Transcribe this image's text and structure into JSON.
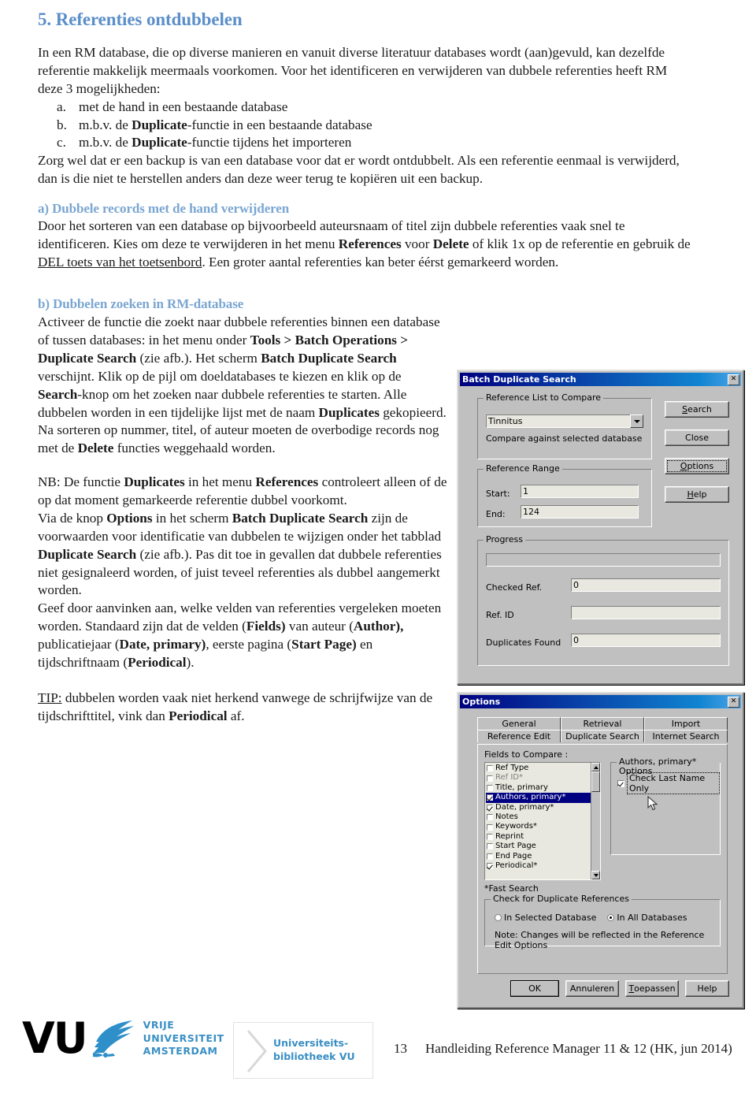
{
  "document": {
    "section_title": "5. Referenties ontdubbelen",
    "intro_p1_a": "In een RM database, die op diverse manieren en vanuit diverse literatuur databases wordt (aan)gevuld, kan dezelfde referentie makkelijk meermaals voorkomen. Voor het identificeren en verwijderen van dubbele referenties heeft RM deze 3 mogelijkheden:",
    "list": [
      {
        "marker": "a.",
        "pre": "met de hand in een bestaande database",
        "bold": "",
        "post": ""
      },
      {
        "marker": "b.",
        "pre": "m.b.v. de ",
        "bold": "Duplicate",
        "post": "-functie in een bestaande database"
      },
      {
        "marker": "c.",
        "pre": "m.b.v. de ",
        "bold": "Duplicate",
        "post": "-functie tijdens het importeren"
      }
    ],
    "intro_p2": "Zorg wel dat er een backup is van een database voor dat er wordt ontdubbelt. Als een referentie eenmaal is verwijderd, dan is die niet te herstellen anders dan deze weer terug te kopiëren uit een backup.",
    "sub_a_title": "a) Dubbele records met de hand verwijderen",
    "sub_a_body_1": "Door het sorteren van een database op bijvoorbeeld auteursnaam of titel zijn dubbele referenties vaak snel te identificeren. Kies om deze te verwijderen in het menu ",
    "sub_a_b1": "References",
    "sub_a_body_2": " voor ",
    "sub_a_b2": "Delete",
    "sub_a_body_3": " of klik 1x op de referentie en gebruik de ",
    "sub_a_u1": "DEL toets van het toetsenbord",
    "sub_a_body_4": ". Een groter aantal referenties kan beter éérst gemarkeerd worden.",
    "sub_b_title": "b) Dubbelen zoeken in RM-database",
    "sub_b_body_1": "Activeer de functie die zoekt naar dubbele referenties binnen een database of tussen databases: in het menu onder ",
    "sub_b_b1": "Tools > Batch Operations > Duplicate Search",
    "sub_b_body_2": " (zie afb.). Het scherm ",
    "sub_b_b2": "Batch Duplicate Search",
    "sub_b_body_3": " verschijnt. Klik op de pijl om doeldatabases te kiezen en klik op de ",
    "sub_b_b3": "Search",
    "sub_b_body_4": "-knop om het zoeken naar dubbele referenties te starten. Alle dubbelen worden in een tijdelijke lijst met de naam ",
    "sub_b_b4": "Duplicates",
    "sub_b_body_5": " gekopieerd. Na sorteren op nummer, titel, of auteur moeten de overbodige records nog met de ",
    "sub_b_b5": "Delete",
    "sub_b_body_6": " functies weggehaald worden.",
    "nb_1": "NB: De functie ",
    "nb_b1": "Duplicates",
    "nb_2": " in het menu ",
    "nb_b2": "References",
    "nb_3": " controleert alleen of de op dat moment gemarkeerde referentie dubbel voorkomt.",
    "via_1": "Via de knop ",
    "via_b1": "Options",
    "via_2": " in het scherm ",
    "via_b2": "Batch Duplicate Search",
    "via_3": " zijn de voorwaarden voor identificatie van dubbelen te wijzigen onder het tabblad ",
    "via_b3": "Duplicate Search",
    "via_4": " (zie afb.). Pas dit toe in gevallen dat dubbele referenties niet gesignaleerd worden, of juist teveel referenties als dubbel aangemerkt worden.",
    "geef_1": "Geef door aanvinken aan, welke velden van referenties vergeleken moeten worden. Standaard zijn dat de velden (",
    "geef_b1": "Fields)",
    "geef_2": " van auteur (",
    "geef_b2": "Author),",
    "geef_3": " publicatiejaar (",
    "geef_b3": "Date, primary)",
    "geef_4": ", eerste pagina (",
    "geef_b4": "Start Page)",
    "geef_5": " en tijdschriftnaam (",
    "geef_b5": "Periodical",
    "geef_6": ").",
    "tip_u": "TIP:",
    "tip_1": " dubbelen worden vaak niet herkend vanwege de schrijfwijze van de tijdschrifttitel, vink dan ",
    "tip_b1": "Periodical",
    "tip_2": " af."
  },
  "colors": {
    "heading": "#5b8fc9",
    "subheading": "#7aa6d2",
    "vu_blue": "#3a8fc4",
    "titlebar_start": "#000080",
    "titlebar_end": "#1084d0",
    "dialog_face": "#c0c0c0",
    "selection": "#000080"
  },
  "batch_dialog": {
    "title": "Batch Duplicate Search",
    "close_glyph": "✕",
    "ref_list_group": "Reference List to Compare",
    "ref_list_value": "Tinnitus",
    "compare_note": "Compare against selected database",
    "range_group": "Reference Range",
    "start_label": "Start:",
    "start_value": "1",
    "end_label": "End:",
    "end_value": "124",
    "progress_group": "Progress",
    "checked_label": "Checked Ref.",
    "checked_value": "0",
    "refid_label": "Ref. ID",
    "refid_value": "",
    "dupfound_label": "Duplicates Found",
    "dupfound_value": "0",
    "buttons": [
      {
        "label": "Search",
        "accel": "S"
      },
      {
        "label": "Close",
        "accel": ""
      },
      {
        "label": "Options",
        "accel": "O"
      },
      {
        "label": "Help",
        "accel": "H"
      }
    ]
  },
  "options_dialog": {
    "title": "Options",
    "close_glyph": "✕",
    "tabs_row1": [
      "General",
      "Retrieval",
      "Import"
    ],
    "tabs_row2": [
      "Reference Edit",
      "Duplicate Search",
      "Internet Search"
    ],
    "active_tab": "Duplicate Search",
    "fields_label": "Fields to Compare :",
    "fields": [
      {
        "label": "Ref Type",
        "checked": false,
        "selected": false,
        "dim": false
      },
      {
        "label": "Ref ID*",
        "checked": false,
        "selected": false,
        "dim": true
      },
      {
        "label": "Title, primary",
        "checked": false,
        "selected": false,
        "dim": false
      },
      {
        "label": "Authors, primary*",
        "checked": true,
        "selected": true,
        "dim": false
      },
      {
        "label": "Date, primary*",
        "checked": true,
        "selected": false,
        "dim": false
      },
      {
        "label": "Notes",
        "checked": false,
        "selected": false,
        "dim": false
      },
      {
        "label": "Keywords*",
        "checked": false,
        "selected": false,
        "dim": false
      },
      {
        "label": "Reprint",
        "checked": false,
        "selected": false,
        "dim": false
      },
      {
        "label": "Start Page",
        "checked": false,
        "selected": false,
        "dim": false
      },
      {
        "label": "End Page",
        "checked": false,
        "selected": false,
        "dim": false
      },
      {
        "label": "Periodical*",
        "checked": true,
        "selected": false,
        "dim": false
      }
    ],
    "authors_group": "Authors, primary* Options",
    "authors_checkbox": "Check Last Name Only",
    "authors_checked": true,
    "fast_search_note": "*Fast Search",
    "check_group": "Check for Duplicate References",
    "radio_selected_db": "In Selected Database",
    "radio_all_db": "In All Databases",
    "radio_value": "In All Databases",
    "note": "Note: Changes will be reflected in the Reference Edit Options",
    "buttons": [
      {
        "label": "OK",
        "accel": "",
        "default": true
      },
      {
        "label": "Annuleren",
        "accel": "",
        "default": false
      },
      {
        "label": "Toepassen",
        "accel": "T",
        "default": false
      },
      {
        "label": "Help",
        "accel": "",
        "default": false
      }
    ]
  },
  "footer": {
    "vu_mark": "VU",
    "vu_line1": "VRIJE",
    "vu_line2": "UNIVERSITEIT",
    "vu_line3": "AMSTERDAM",
    "ub_line1": "Universiteits-",
    "ub_line2": "bibliotheek VU",
    "page_number": "13",
    "doc_title": "Handleiding Reference Manager 11 & 12 (HK, jun 2014)"
  }
}
